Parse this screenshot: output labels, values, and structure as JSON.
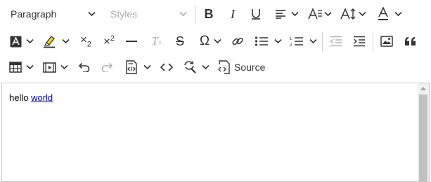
{
  "toolbar": {
    "heading_select": {
      "value": "Paragraph"
    },
    "style_select": {
      "placeholder": "Styles"
    },
    "source_button": {
      "label": "Source"
    },
    "buttons": [
      "bold",
      "italic",
      "underline",
      "alignment",
      "font-size",
      "line-height",
      "font-color",
      "background-color",
      "highlight",
      "subscript",
      "superscript",
      "horizontal-line",
      "remove-format",
      "strikethrough",
      "special-characters",
      "link",
      "bulleted-list",
      "numbered-list",
      "outdent",
      "indent",
      "insert-image",
      "block-quote",
      "insert-table",
      "insert-media",
      "undo",
      "redo",
      "html-embed",
      "code",
      "find-and-replace"
    ]
  },
  "editor": {
    "text_plain": "hello ",
    "text_link": "world"
  },
  "colors": {
    "icon": "#333333",
    "disabled": "#b0b0b0",
    "separator": "#d4d4d4",
    "link": "#0000cc",
    "highlight": "#f5d800"
  }
}
